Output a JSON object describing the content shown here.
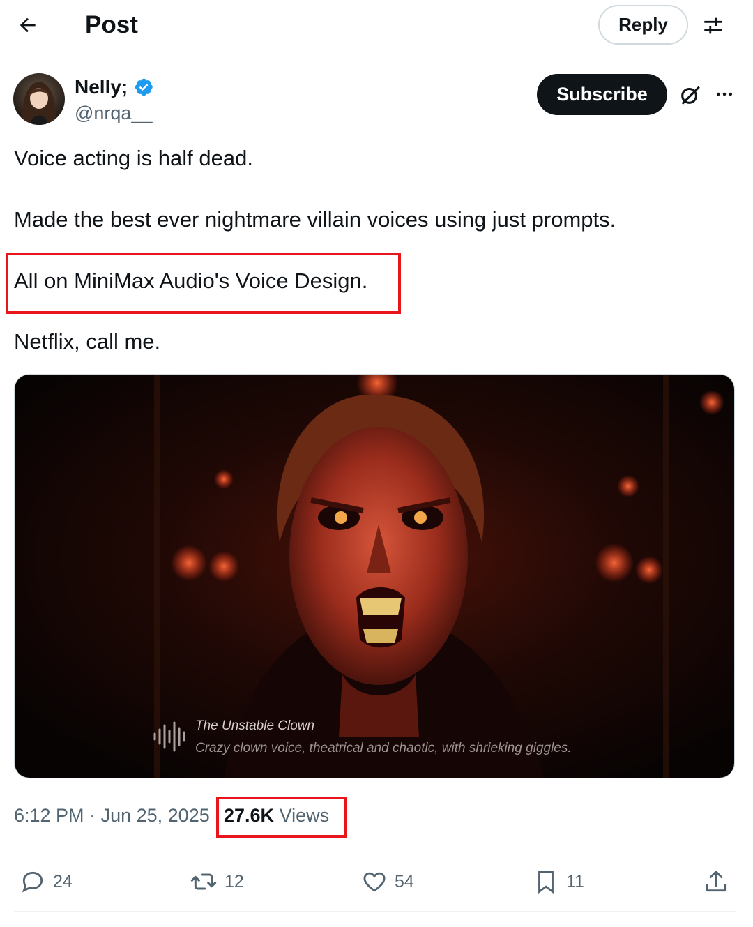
{
  "header": {
    "title": "Post",
    "reply_label": "Reply",
    "back_icon": "arrow-left-icon",
    "filter_icon": "sliders-icon"
  },
  "author": {
    "display_name": "Nelly;",
    "handle": "@nrqa__",
    "verified": true,
    "subscribe_label": "Subscribe"
  },
  "post": {
    "lines": [
      "Voice acting is half dead.",
      "Made the best ever nightmare villain voices using just prompts.",
      "All on MiniMax Audio's Voice Design.",
      "Netflix, call me."
    ],
    "media": {
      "caption_title": "The Unstable Clown",
      "caption_desc": "Crazy clown voice, theatrical and chaotic, with shrieking giggles."
    },
    "time": "6:12 PM",
    "separator": "·",
    "date": "Jun 25, 2025",
    "views_count": "27.6K",
    "views_label": "Views"
  },
  "actions": {
    "replies": "24",
    "reposts": "12",
    "likes": "54",
    "bookmarks": "11"
  },
  "colors": {
    "highlight": "#e8161b",
    "verified": "#1d9bf0",
    "muted": "#536471"
  }
}
